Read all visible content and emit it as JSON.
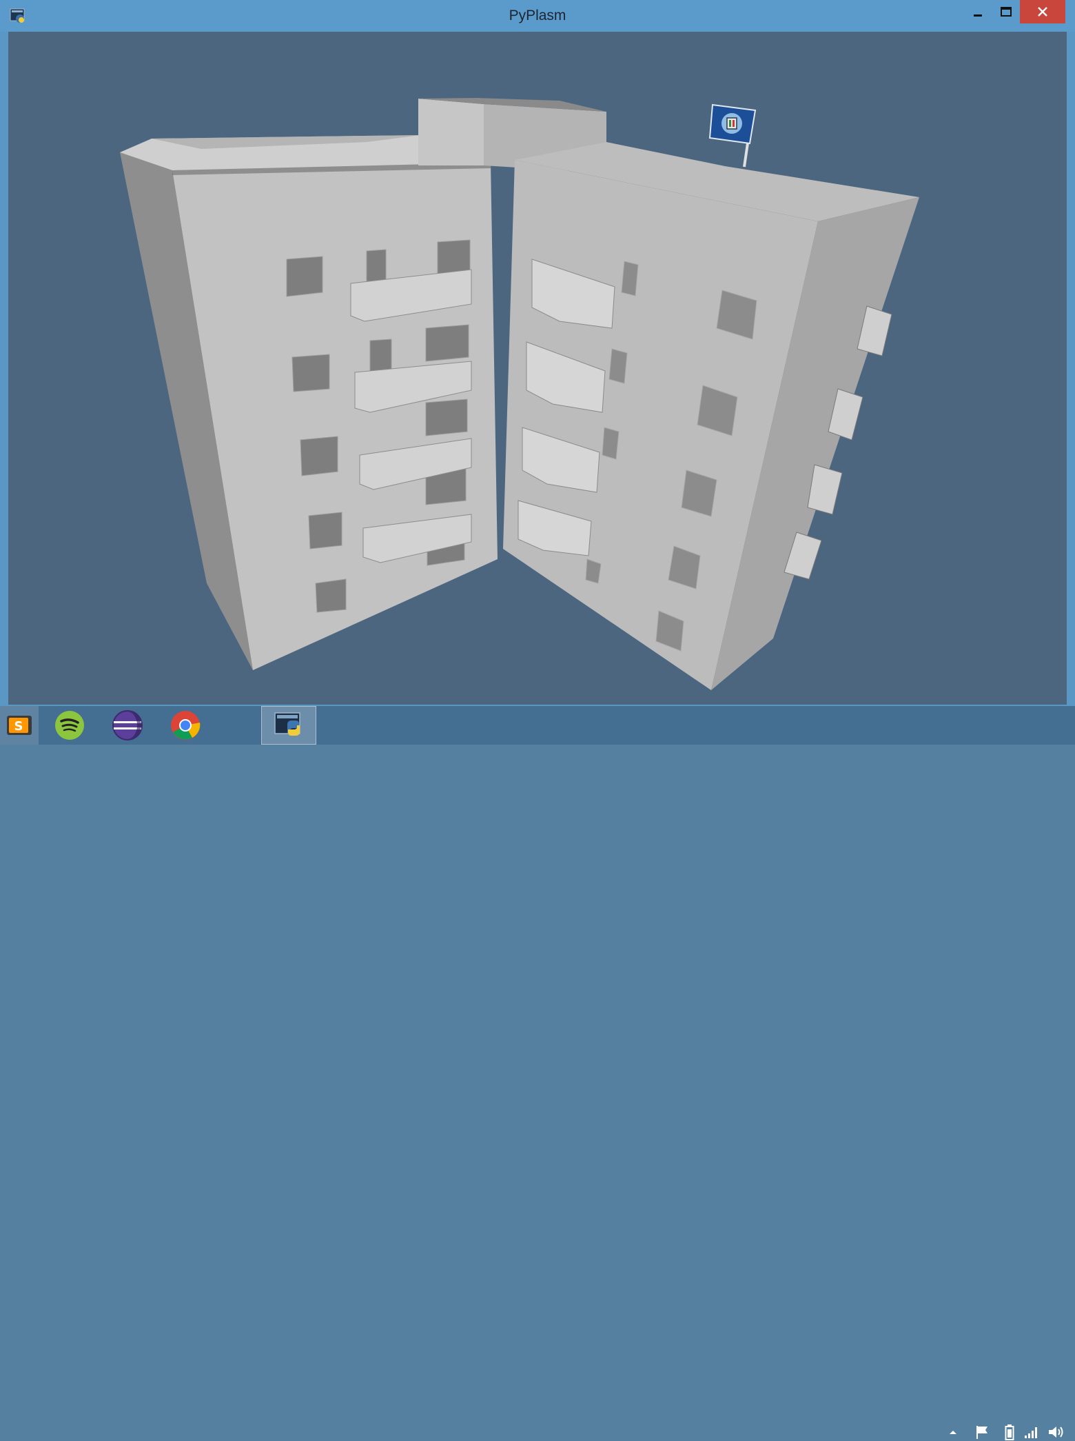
{
  "window": {
    "title": "PyPlasm",
    "icons": {
      "app": "pyplasm-app-icon",
      "minimize": "minimize-icon",
      "maximize": "maximize-icon",
      "close": "close-icon"
    }
  },
  "viewport": {
    "content": "3d-building-model",
    "background_color": "#4c6680",
    "model_color": "#c8c8c8",
    "flag_icon": "flag-emblem-icon"
  },
  "taskbar": {
    "items": [
      {
        "name": "sublime-text",
        "icon": "sublime-text-icon",
        "active": false
      },
      {
        "name": "spotify",
        "icon": "spotify-icon",
        "active": false
      },
      {
        "name": "eclipse",
        "icon": "eclipse-icon",
        "active": false
      },
      {
        "name": "chrome",
        "icon": "chrome-icon",
        "active": false
      },
      {
        "name": "python-pyplasm",
        "icon": "python-icon",
        "active": true
      }
    ],
    "tray": [
      "show-hidden-icons-chevron",
      "action-center-flag-icon",
      "battery-icon",
      "network-signal-icon",
      "volume-icon"
    ]
  },
  "colors": {
    "titlebar": "#5b9bcc",
    "close_button": "#c9463d",
    "taskbar": "#446f93"
  }
}
